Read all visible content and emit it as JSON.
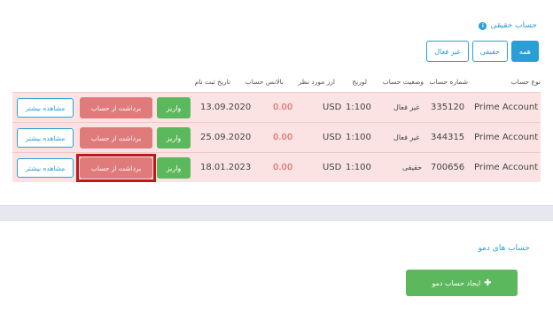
{
  "section": {
    "title": "حساب حقیقی",
    "info_glyph": "i"
  },
  "filters": [
    {
      "label": "همه",
      "active": true
    },
    {
      "label": "حقیقی",
      "active": false
    },
    {
      "label": "غیر فعال",
      "active": false
    }
  ],
  "columns": {
    "account_type": "نوع حساب",
    "account_number": "شماره حساب",
    "status": "وضعیت حساب",
    "leverage": "لوریج",
    "currency": "ارز مورد نظر",
    "balance": "بالانس حساب",
    "reg_date": "تاریخ ثبت نام"
  },
  "rows": [
    {
      "account_type": "Prime Account",
      "account_number": "335120",
      "status": "غیر فعال",
      "leverage": "1:100",
      "currency": "USD",
      "balance": "0.00",
      "reg_date": "13.09.2020",
      "deposit": "واریز",
      "withdraw": "برداشت از حساب",
      "more": "مشاهده بیشتر"
    },
    {
      "account_type": "Prime Account",
      "account_number": "344315",
      "status": "غیر فعال",
      "leverage": "1:100",
      "currency": "USD",
      "balance": "0.00",
      "reg_date": "25.09.2020",
      "deposit": "واریز",
      "withdraw": "برداشت از حساب",
      "more": "مشاهده بیشتر"
    },
    {
      "account_type": "Prime Account",
      "account_number": "700656",
      "status": "حقیقی",
      "leverage": "1:100",
      "currency": "USD",
      "balance": "0.00",
      "reg_date": "18.01.2023",
      "deposit": "واریز",
      "withdraw": "برداشت از حساب",
      "more": "مشاهده بیشتر"
    }
  ],
  "demo": {
    "title": "حساب های دمو",
    "create_label": "ایجاد حساب دمو",
    "create_icon": "plus-icon"
  },
  "colors": {
    "accent": "#2a9fd6",
    "success": "#5cb85c",
    "danger": "#d9534f",
    "row_bg": "#fbe3e3",
    "highlight": "#c0161c"
  }
}
